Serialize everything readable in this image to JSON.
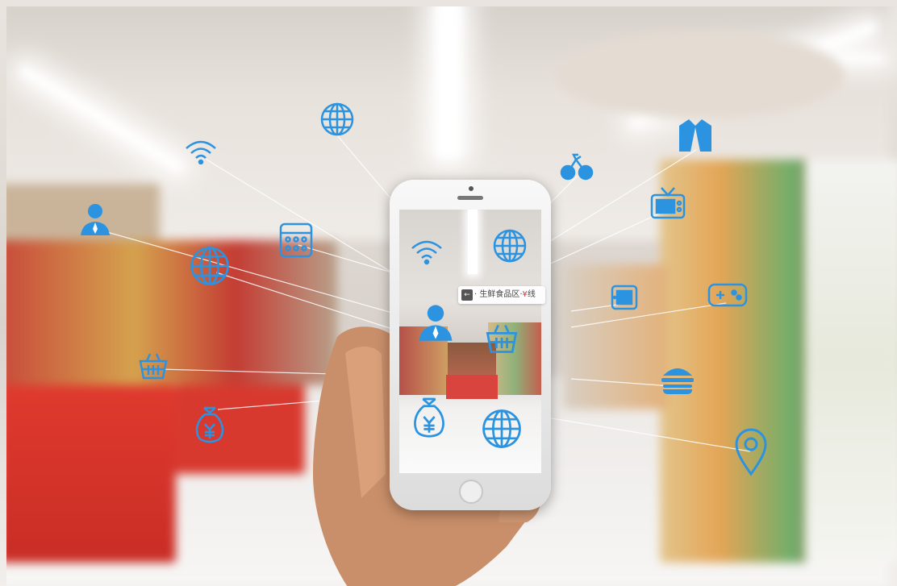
{
  "sign": {
    "arrow": "←",
    "text_left": "· 生鲜食品区·",
    "text_red": "¥",
    "text_right": "线"
  },
  "icons": [
    "wifi-icon",
    "globe-icon",
    "user-icon",
    "calculator-icon",
    "globe-icon",
    "basket-icon",
    "money-bag-icon",
    "bicycle-icon",
    "jacket-icon",
    "tv-icon",
    "globe-icon",
    "tablet-icon",
    "gamepad-icon",
    "burger-icon",
    "location-pin-icon",
    "wifi-icon",
    "user-icon",
    "basket-icon",
    "money-bag-icon",
    "globe-icon"
  ],
  "colors": {
    "icon_blue": "#2b93e0",
    "sign_red": "#d23b3b"
  }
}
